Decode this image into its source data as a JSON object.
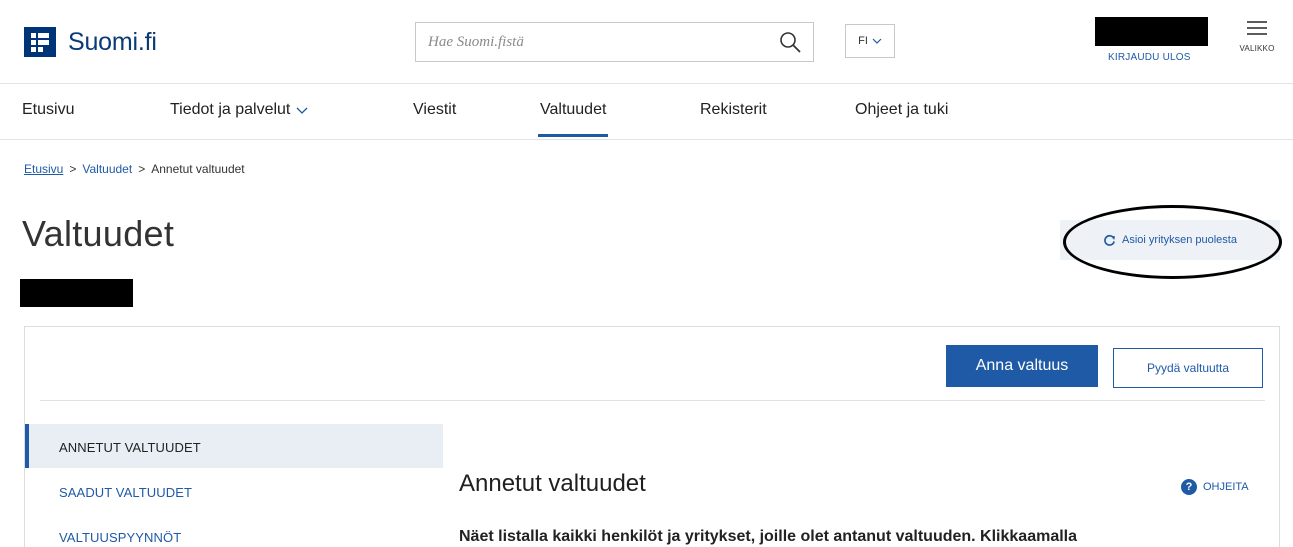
{
  "header": {
    "logo_text": "Suomi.fi",
    "search_placeholder": "Hae Suomi.fistä",
    "lang": "FI",
    "logout": "KIRJAUDU ULOS",
    "menu_label": "VALIKKO"
  },
  "nav": {
    "items": [
      {
        "label": "Etusivu"
      },
      {
        "label": "Tiedot ja palvelut"
      },
      {
        "label": "Viestit"
      },
      {
        "label": "Valtuudet"
      },
      {
        "label": "Rekisterit"
      },
      {
        "label": "Ohjeet ja tuki"
      }
    ],
    "active": "Valtuudet"
  },
  "breadcrumb": {
    "items": [
      "Etusivu",
      "Valtuudet",
      "Annetut valtuudet"
    ],
    "separator": ">"
  },
  "page": {
    "title": "Valtuudet",
    "company_button": "Asioi yrityksen puolesta"
  },
  "panel": {
    "primary_button": "Anna valtuus",
    "secondary_button": "Pyydä valtuutta",
    "sidebar": [
      "ANNETUT VALTUUDET",
      "SAADUT VALTUUDET",
      "VALTUUSPYYNNÖT"
    ],
    "section_title": "Annetut valtuudet",
    "help_label": "OHJEITA",
    "description": "Näet listalla kaikki henkilöt ja yritykset, joille olet antanut valtuuden. Klikkaamalla"
  },
  "colors": {
    "brand": "#003479",
    "link": "#1f5aa6",
    "active_bg": "#e9eef5"
  },
  "icons": [
    "grid-logo-icon",
    "search-icon",
    "chevron-down-icon",
    "hamburger-menu-icon",
    "refresh-icon",
    "help-icon"
  ]
}
